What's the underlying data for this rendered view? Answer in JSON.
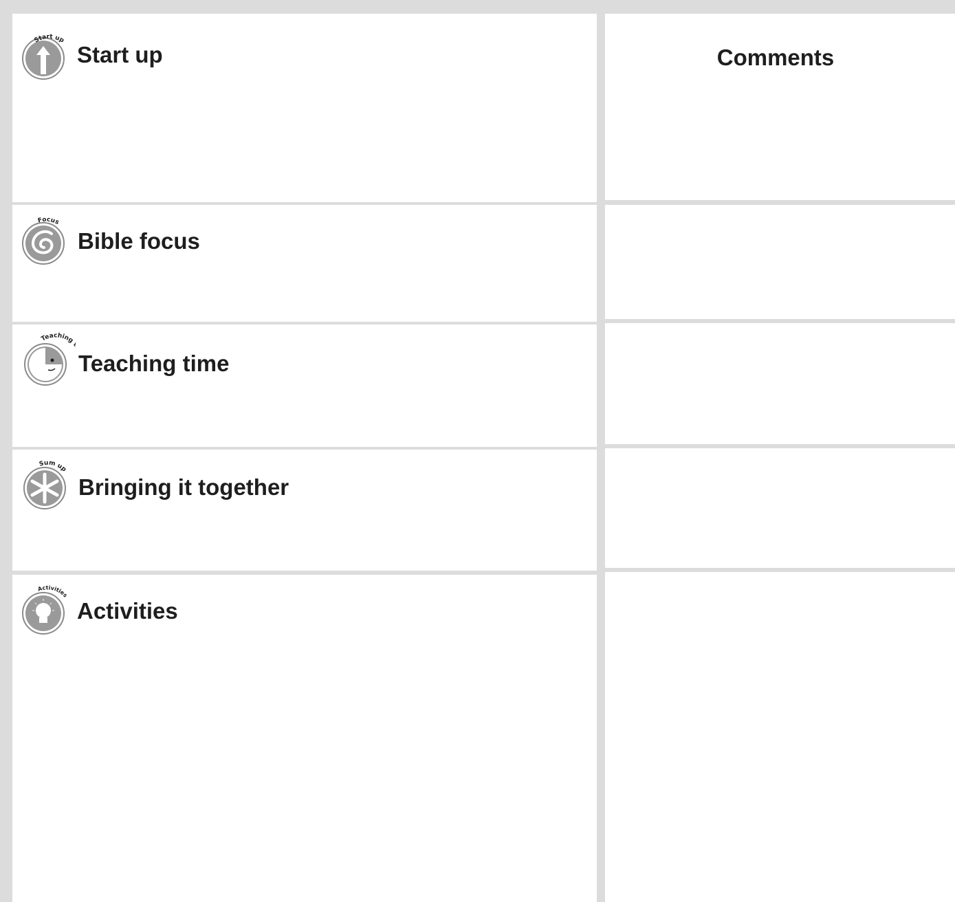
{
  "sections": [
    {
      "title": "Start up",
      "icon": "start-up-arrow-icon",
      "badge_text": "Start up"
    },
    {
      "title": "Bible focus",
      "icon": "focus-spiral-icon",
      "badge_text": "Focus"
    },
    {
      "title": "Teaching time",
      "icon": "teaching-time-face-icon",
      "badge_text": "Teaching time"
    },
    {
      "title": "Bringing it together",
      "icon": "sum-up-asterisk-icon",
      "badge_text": "Sum up"
    },
    {
      "title": "Activities",
      "icon": "activities-lightbulb-icon",
      "badge_text": "Activities"
    }
  ],
  "comments": {
    "title": "Comments"
  },
  "colors": {
    "frame": "#dcdcdc",
    "cell": "#ffffff",
    "icon_fill": "#9a9a9a",
    "text": "#1e1e1e"
  }
}
